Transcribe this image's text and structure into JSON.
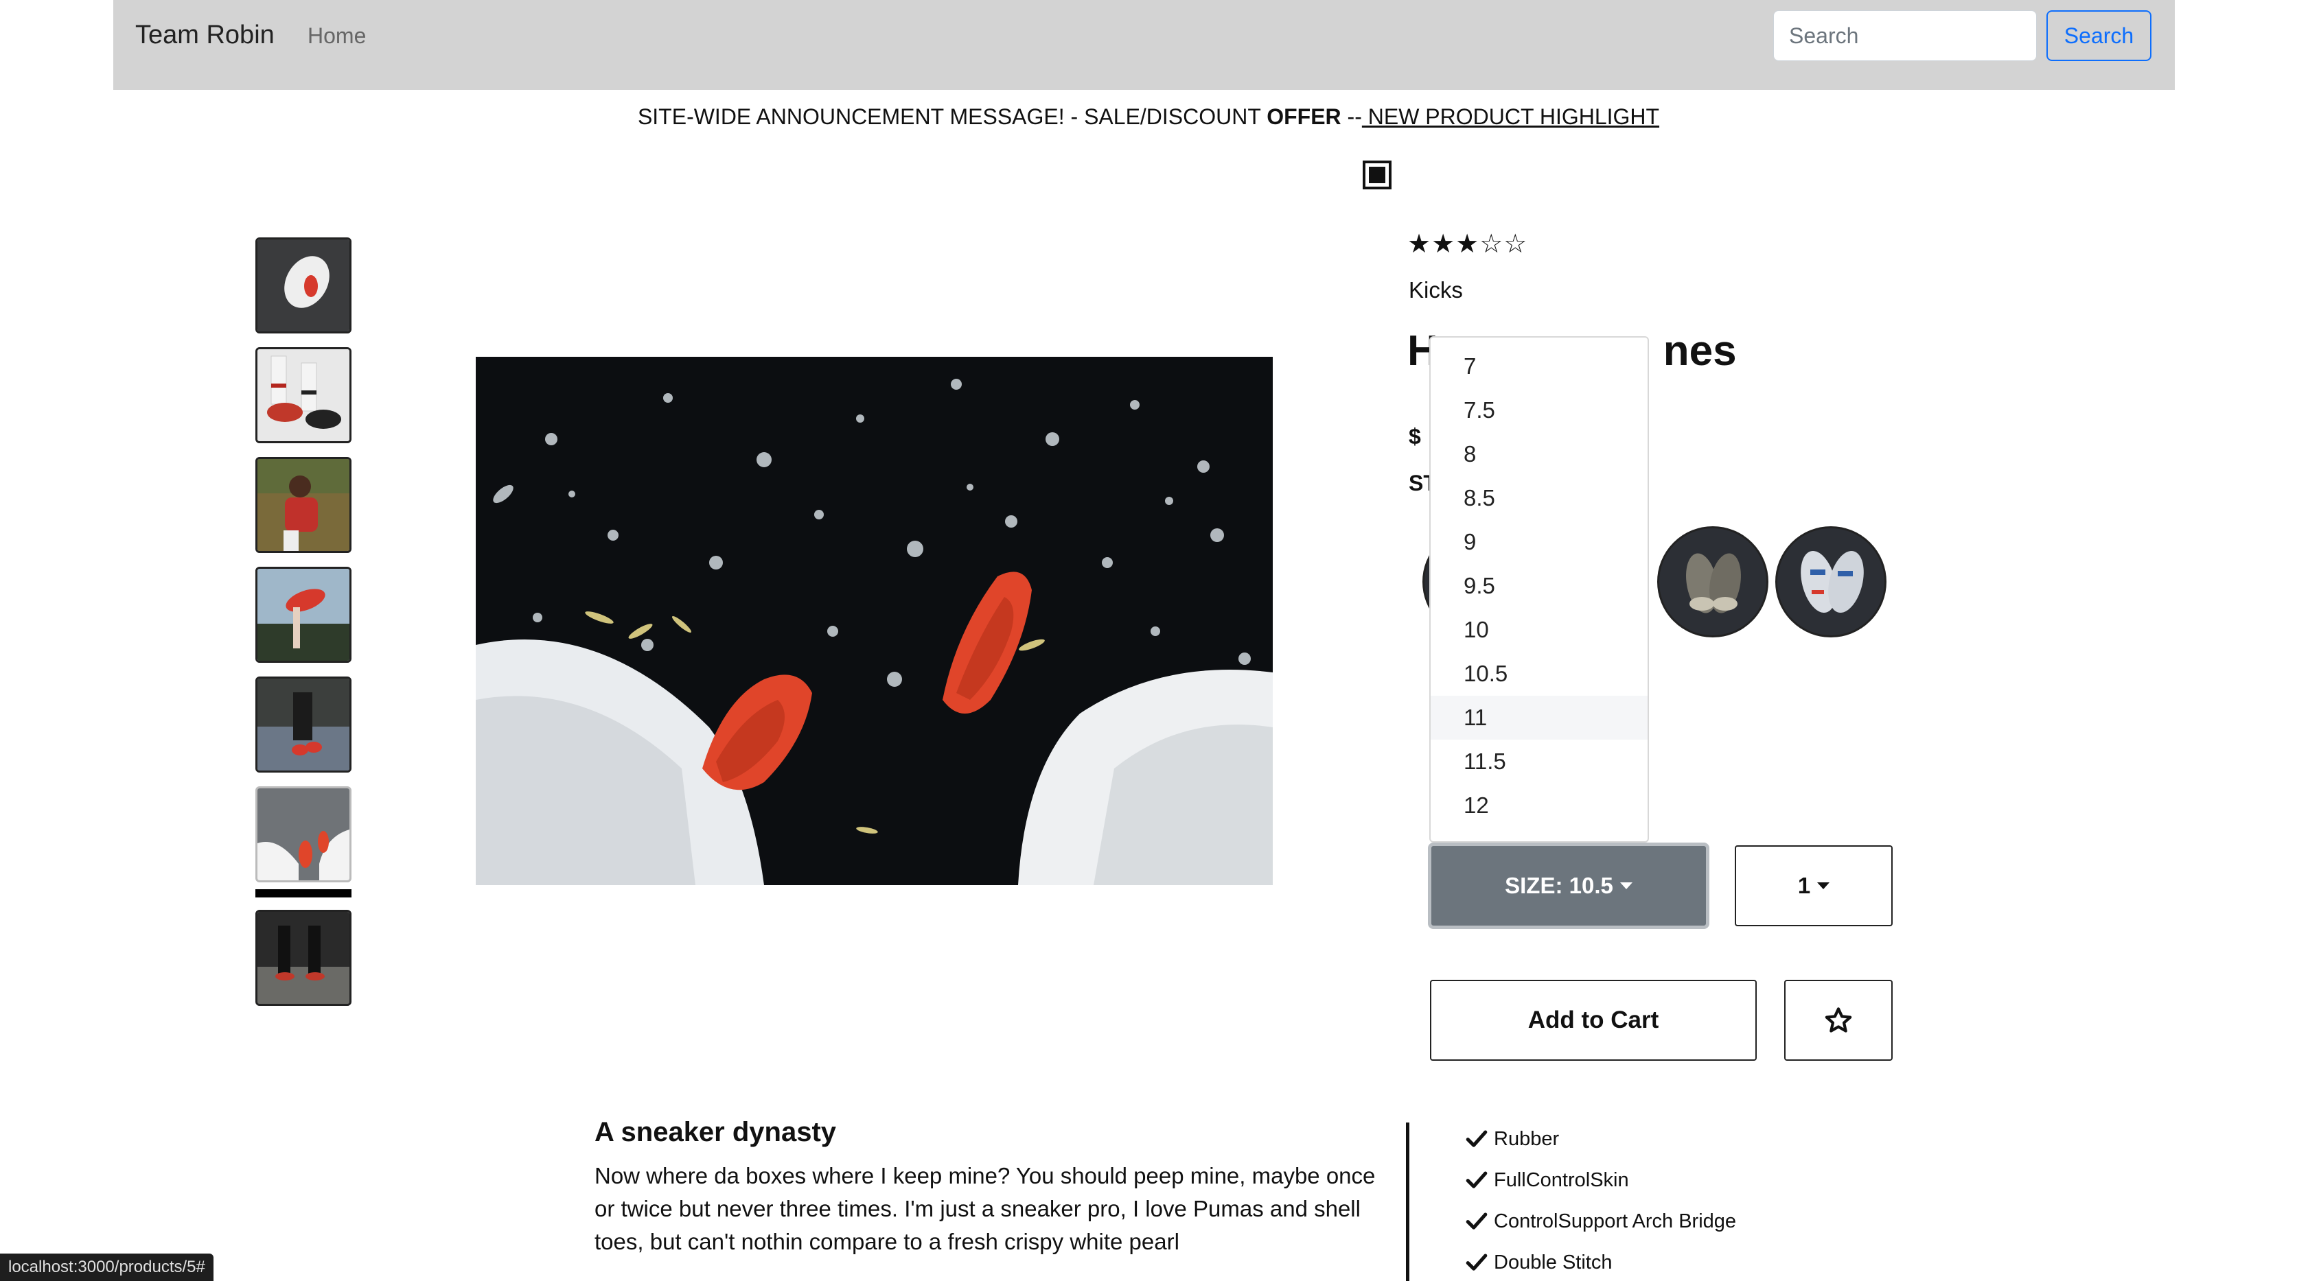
{
  "navbar": {
    "brand": "Team Robin",
    "home_link": "Home",
    "search_placeholder": "Search",
    "search_button": "Search"
  },
  "announcement": {
    "prefix": "SITE-WIDE ANNOUNCEMENT MESSAGE! - SALE/DISCOUNT ",
    "offer": "OFFER",
    "separator": " --",
    "highlight_link": " NEW PRODUCT HIGHLIGHT"
  },
  "gallery": {
    "thumbnail_count": 7,
    "selected_index": 5
  },
  "product": {
    "rating": "★★★☆☆",
    "rating_value": 3,
    "rating_max": 5,
    "category": "Kicks",
    "title_visible_start": "H",
    "title_visible_end": "nes",
    "price_visible": "$",
    "style_visible": "ST"
  },
  "size_menu": {
    "options": [
      "7",
      "7.5",
      "8",
      "8.5",
      "9",
      "9.5",
      "10",
      "10.5",
      "11",
      "11.5",
      "12"
    ],
    "hovered": "11"
  },
  "controls": {
    "size_button": "SIZE: 10.5",
    "quantity_button": "1",
    "add_to_cart": "Add to Cart"
  },
  "description": {
    "title": "A sneaker dynasty",
    "body": "Now where da boxes where I keep mine? You should peep mine, maybe once or twice but never three times. I'm just a sneaker pro, I love Pumas and shell toes, but can't nothin compare to a fresh crispy white pearl"
  },
  "features": [
    "Rubber",
    "FullControlSkin",
    "ControlSupport Arch Bridge",
    "Double Stitch"
  ],
  "status_bar": "localhost:3000/products/5#",
  "colors": {
    "navbar_bg": "#d3d3d3",
    "accent_blue": "#0d6efd",
    "size_button_bg": "#6c757d",
    "sneaker_red": "#e0452a"
  }
}
